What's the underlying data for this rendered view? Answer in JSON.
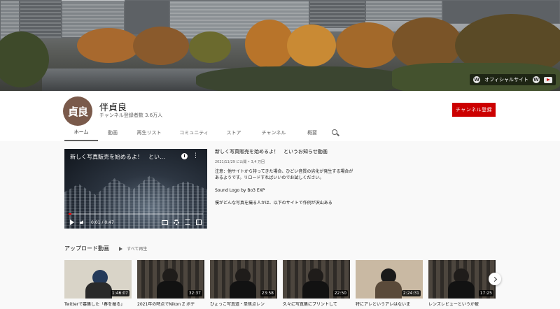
{
  "banner": {
    "links": {
      "official_site": "オフィシャルサイト"
    }
  },
  "channel": {
    "avatar_text": "貞良",
    "name": "伴貞良",
    "subscribers": "チャンネル登録者数 3.6万人",
    "subscribe_label": "チャンネル登録"
  },
  "tabs": [
    {
      "label": "ホーム",
      "active": true
    },
    {
      "label": "動画"
    },
    {
      "label": "再生リスト"
    },
    {
      "label": "コミュニティ"
    },
    {
      "label": "ストア"
    },
    {
      "label": "チャンネル"
    },
    {
      "label": "概要"
    }
  ],
  "featured": {
    "player_title": "新しく写真販売を始めるよ！　とい...",
    "time_current": "0:01",
    "time_total": "0:47",
    "progress": 0.02,
    "title": "新しく写真販売を始めるよ！　というお知らせ動画",
    "meta": "2021/11/29 に公開 • 3,4 万回",
    "body_1": "注意：他サイトから持ってきた場合、ひどい音質の劣化が発生する場合があるようです。リロードすればいいのでお試しください。",
    "body_2": "Sound Logo by Bo3 EXP",
    "body_3": "僕がどんな写真を撮る人かは、以下のサイトで作例が沢山ある"
  },
  "uploads": {
    "title": "アップロード動画",
    "play_all": "すべて再生",
    "videos": [
      {
        "duration": "1:46:07",
        "title": "Twitterで募集した「春を撮る」"
      },
      {
        "duration": "32:37",
        "title": "2021年の時点でNikon Z ボデ"
      },
      {
        "duration": "23:58",
        "title": "ひょっこ写真道・単焦点レン"
      },
      {
        "duration": "22:50",
        "title": "久々に写真集にプリントして"
      },
      {
        "duration": "2:24:31",
        "title": "特にアレというアレはないま"
      },
      {
        "duration": "17:25",
        "title": "レンズレビューというか被"
      }
    ]
  },
  "colors": {
    "subscribe": "#cc0000",
    "progress": "#ff0000",
    "avatar": "#7a5a4b"
  }
}
